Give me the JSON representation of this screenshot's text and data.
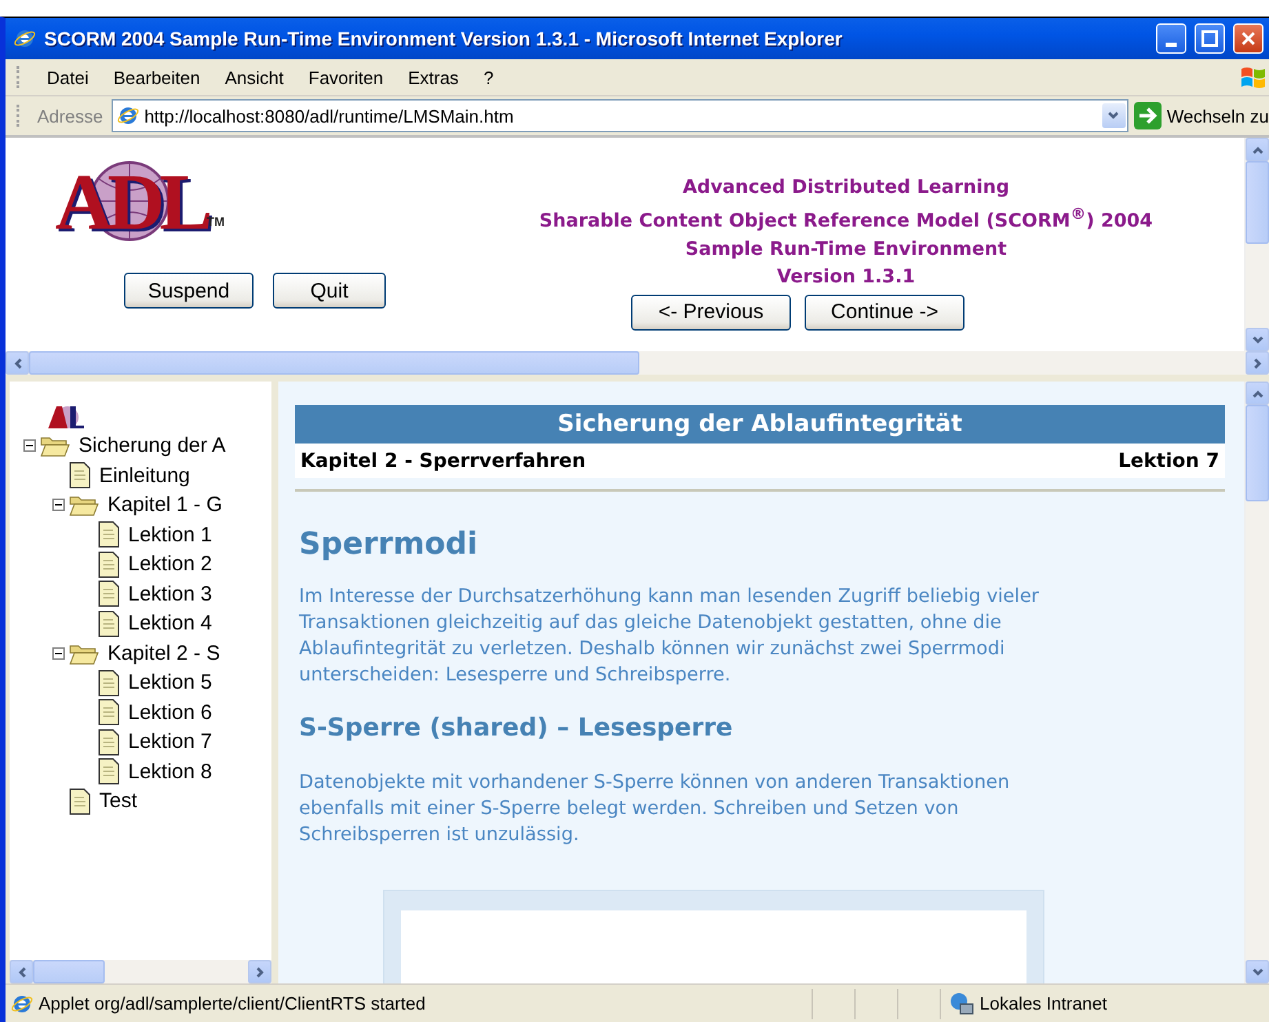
{
  "window": {
    "title": "SCORM 2004 Sample Run-Time Environment Version 1.3.1 - Microsoft Internet Explorer"
  },
  "menu": [
    "Datei",
    "Bearbeiten",
    "Ansicht",
    "Favoriten",
    "Extras",
    "?"
  ],
  "address_bar": {
    "label": "Adresse",
    "url": "http://localhost:8080/adl/runtime/LMSMain.htm",
    "go": "Wechseln zu"
  },
  "header": {
    "logo": {
      "text": "ADL",
      "mark": "TM"
    },
    "lines": [
      "Advanced Distributed Learning",
      "Sharable Content Object Reference Model (SCORM$^{®}$) 2004",
      "Sample Run-Time Environment",
      "Version 1.3.1"
    ],
    "left_buttons": [
      "Suspend",
      "Quit"
    ],
    "nav_buttons": [
      "<- Previous",
      "Continue ->"
    ]
  },
  "tree": [
    {
      "label": "Sicherung der A",
      "kind": "folder",
      "expanded": true,
      "children": [
        {
          "label": "Einleitung",
          "kind": "page"
        },
        {
          "label": "Kapitel 1 - G",
          "kind": "folder",
          "expanded": true,
          "children": [
            {
              "label": "Lektion 1",
              "kind": "page"
            },
            {
              "label": "Lektion 2",
              "kind": "page"
            },
            {
              "label": "Lektion 3",
              "kind": "page"
            },
            {
              "label": "Lektion 4",
              "kind": "page"
            }
          ]
        },
        {
          "label": "Kapitel 2 - S",
          "kind": "folder",
          "expanded": true,
          "children": [
            {
              "label": "Lektion 5",
              "kind": "page"
            },
            {
              "label": "Lektion 6",
              "kind": "page"
            },
            {
              "label": "Lektion 7",
              "kind": "page"
            },
            {
              "label": "Lektion 8",
              "kind": "page"
            }
          ]
        },
        {
          "label": "Test",
          "kind": "page"
        }
      ]
    }
  ],
  "content": {
    "title": "Sicherung der Ablaufintegrität",
    "chapter": "Kapitel 2 - Sperrverfahren",
    "lesson": "Lektion 7",
    "blocks": [
      {
        "kind": "heading",
        "text": "Sperrmodi"
      },
      {
        "kind": "paragraph",
        "text": "Im Interesse der Durchsatzerhöhung kann man lesenden Zugriff beliebig vieler Transaktionen gleichzeitig auf das gleiche Datenobjekt gestatten, ohne die Ablaufintegrität zu verletzen. Deshalb können wir zunächst zwei Sperrmodi unterscheiden: Lesesperre und Schreibsperre."
      },
      {
        "kind": "subheading",
        "text": "S-Sperre (shared) – Lesesperre"
      },
      {
        "kind": "paragraph",
        "text": "Datenobjekte mit vorhandener S-Sperre können von anderen Transaktionen ebenfalls mit einer S-Sperre belegt werden. Schreiben und Setzen von Schreibsperren ist unzulässig."
      },
      {
        "kind": "figure"
      }
    ]
  },
  "status_bar": {
    "message": "Applet org/adl/samplerte/client/ClientRTS started",
    "zone": "Lokales Intranet"
  }
}
